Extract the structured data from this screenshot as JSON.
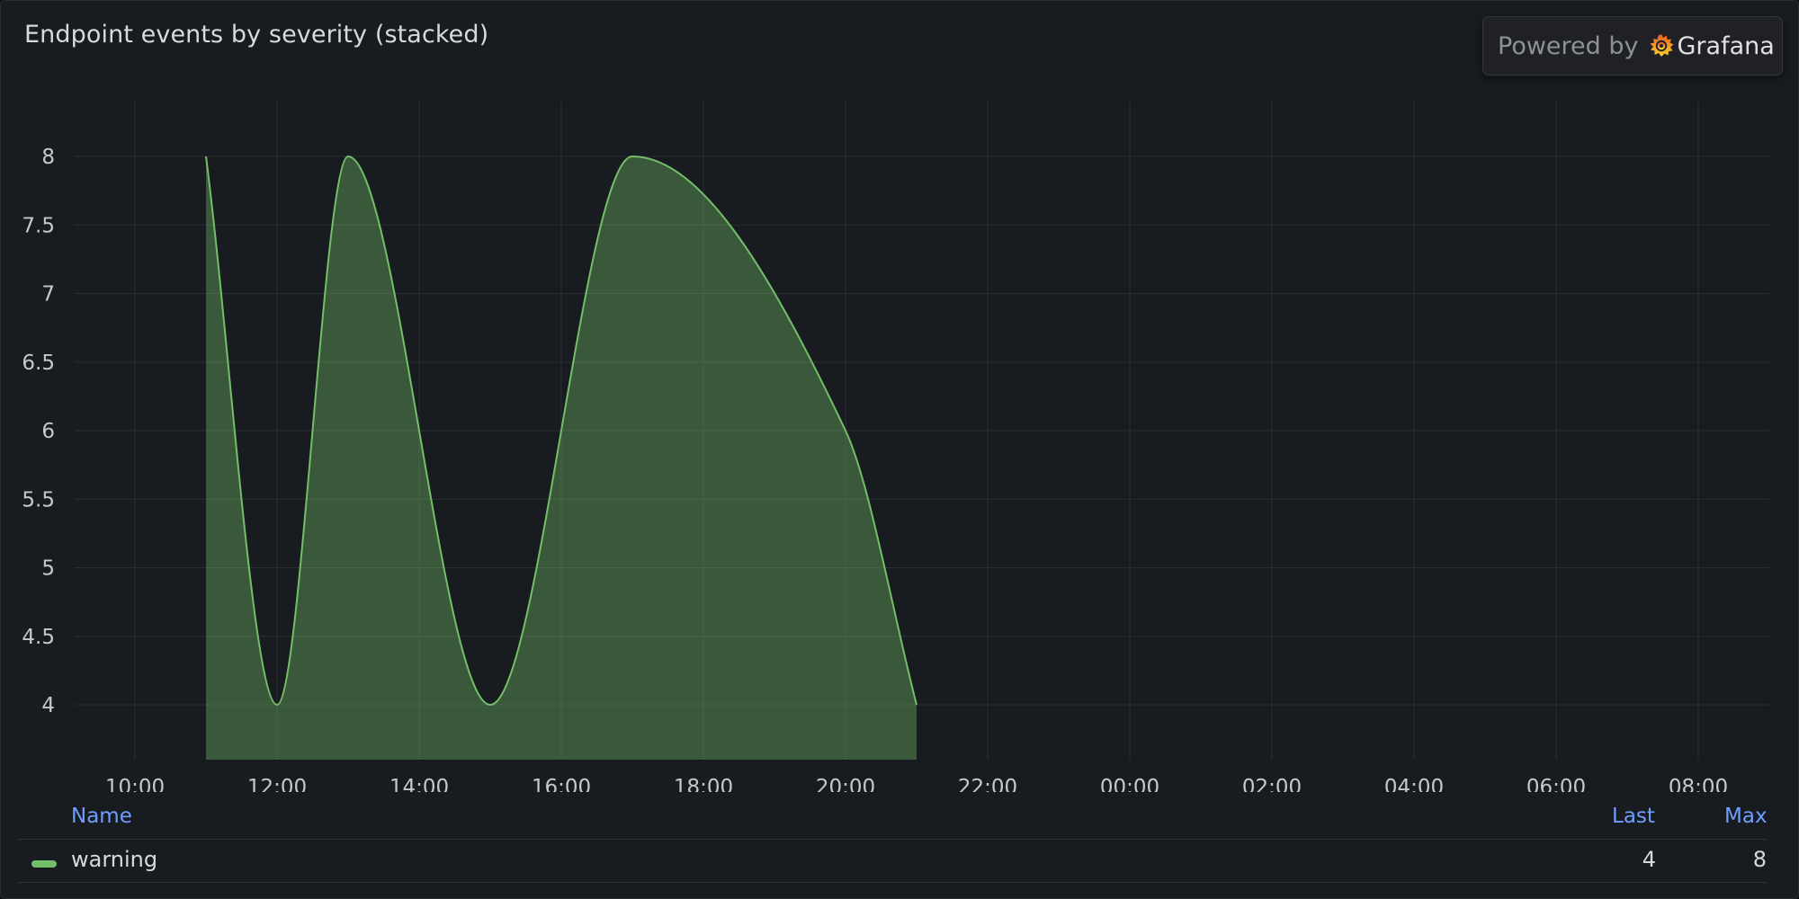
{
  "panel": {
    "title": "Endpoint events by severity (stacked)",
    "powered_by": "Powered by",
    "brand": "Grafana"
  },
  "chart_data": {
    "type": "area",
    "x_tick_labels": [
      "10:00",
      "12:00",
      "14:00",
      "16:00",
      "18:00",
      "20:00",
      "22:00",
      "00:00",
      "02:00",
      "04:00",
      "06:00",
      "08:00"
    ],
    "y_tick_labels": [
      "4",
      "4.5",
      "5",
      "5.5",
      "6",
      "6.5",
      "7",
      "7.5",
      "8"
    ],
    "y_ticks": [
      4,
      4.5,
      5,
      5.5,
      6,
      6.5,
      7,
      7.5,
      8
    ],
    "x_range_hours": [
      9.25,
      33
    ],
    "ylim": [
      3.6,
      8.4
    ],
    "grid": true,
    "legend_placement": "bottom",
    "series": [
      {
        "name": "warning",
        "color": "#73bf69",
        "x": [
          "11:00",
          "12:00",
          "13:00",
          "15:00",
          "17:00",
          "20:00",
          "21:00"
        ],
        "values": [
          8,
          4,
          8,
          4,
          8,
          6,
          4
        ]
      }
    ]
  },
  "legend": {
    "headers": {
      "name": "Name",
      "last": "Last",
      "max": "Max"
    },
    "rows": [
      {
        "name": "warning",
        "last": "4",
        "max": "8",
        "color": "#73bf69"
      }
    ]
  }
}
